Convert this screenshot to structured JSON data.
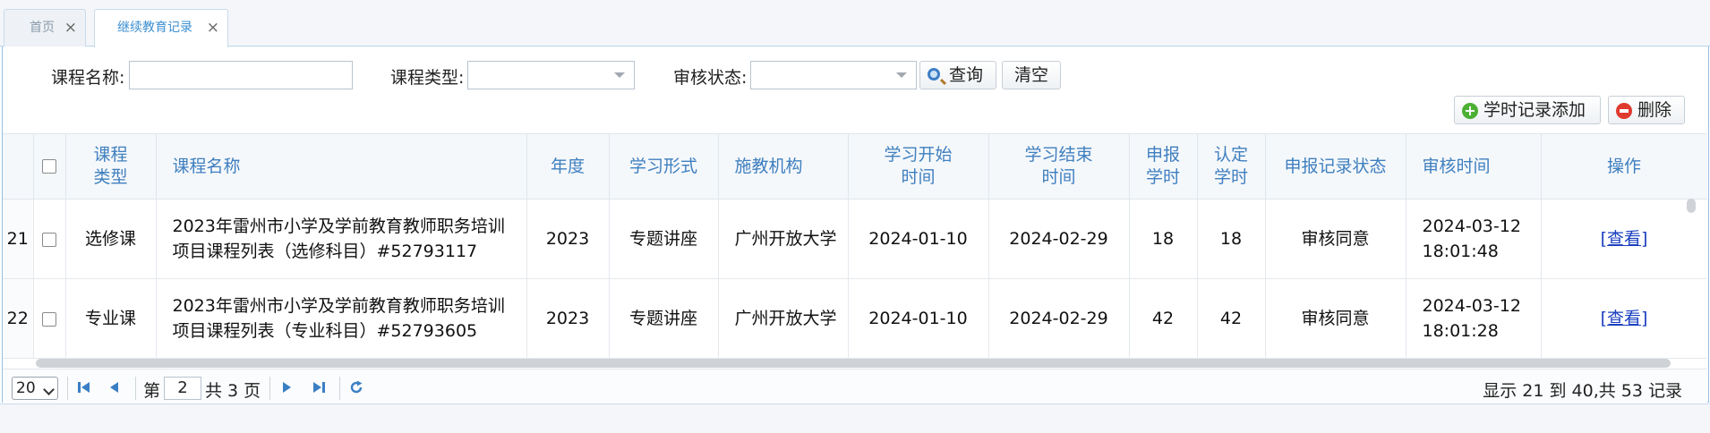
{
  "tabs": [
    {
      "label": "首页"
    },
    {
      "label": "继续教育记录"
    }
  ],
  "search": {
    "course_name_label": "课程名称:",
    "course_name_value": "",
    "course_type_label": "课程类型:",
    "course_type_value": "",
    "review_status_label": "审核状态:",
    "review_status_value": "",
    "query_label": "查询",
    "clear_label": "清空"
  },
  "toolbar": {
    "add_label": "学时记录添加",
    "delete_label": "删除"
  },
  "table": {
    "headers": {
      "course_type": [
        "课程",
        "类型"
      ],
      "course_name": "课程名称",
      "year": "年度",
      "study_form": "学习形式",
      "institution": "施教机构",
      "start": [
        "学习开始",
        "时间"
      ],
      "end": [
        "学习结束",
        "时间"
      ],
      "declared": [
        "申报",
        "学时"
      ],
      "approved": [
        "认定",
        "学时"
      ],
      "status": "申报记录状态",
      "review_time": "审核时间",
      "action": "操作"
    },
    "rows": [
      {
        "num": "21",
        "course_type": "选修课",
        "course_name": "2023年雷州市小学及学前教育教师职务培训项目课程列表（选修科目）#52793117",
        "year": "2023",
        "study_form": "专题讲座",
        "institution": "广州开放大学",
        "start": "2024-01-10",
        "end": "2024-02-29",
        "declared": "18",
        "approved": "18",
        "status": "审核同意",
        "review_time": "2024-03-12 18:01:48",
        "action": "[查看]"
      },
      {
        "num": "22",
        "course_type": "专业课",
        "course_name": "2023年雷州市小学及学前教育教师职务培训项目课程列表（专业科目）#52793605",
        "year": "2023",
        "study_form": "专题讲座",
        "institution": "广州开放大学",
        "start": "2024-01-10",
        "end": "2024-02-29",
        "declared": "42",
        "approved": "42",
        "status": "审核同意",
        "review_time": "2024-03-12 18:01:28",
        "action": "[查看]"
      }
    ]
  },
  "pager": {
    "page_size": "20",
    "page_prefix": "第",
    "page_current": "2",
    "page_total_text": "共 3 页",
    "info": "显示 21 到 40,共 53 记录"
  },
  "colors": {
    "header_text": "#3f7fbf",
    "active_tab": "#3d8fd1",
    "border": "#95c0e2",
    "link": "#1a3fbf"
  },
  "icons": [
    "close-icon",
    "search-icon",
    "add-icon",
    "delete-icon",
    "first-page-icon",
    "prev-page-icon",
    "next-page-icon",
    "last-page-icon",
    "refresh-icon"
  ]
}
